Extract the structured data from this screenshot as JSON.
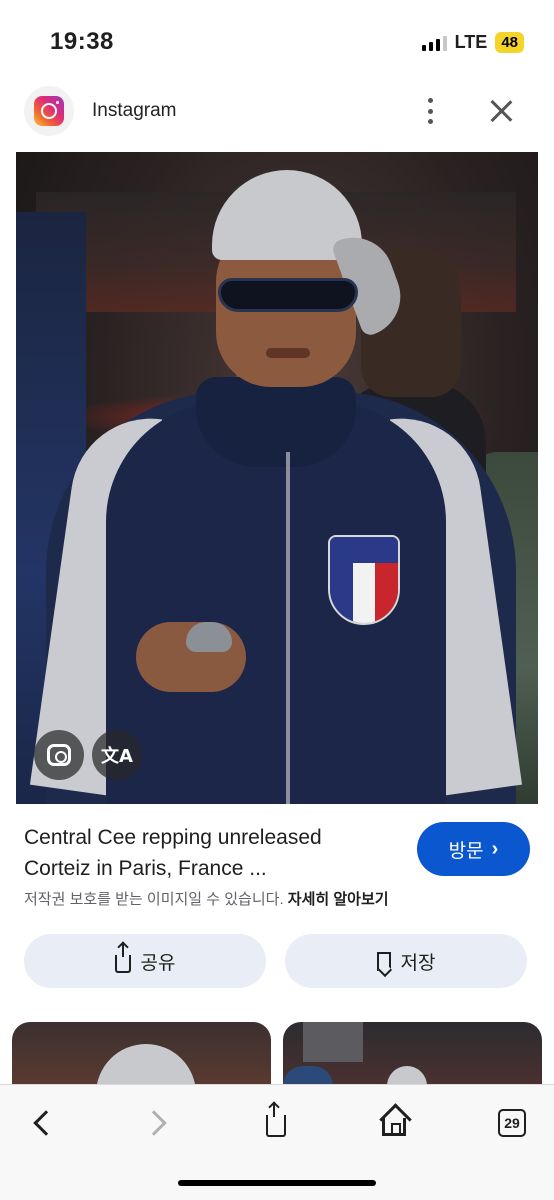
{
  "status_bar": {
    "time": "19:38",
    "network": "LTE",
    "battery": "48"
  },
  "header": {
    "app_name": "Instagram",
    "logo_icon": "instagram-logo",
    "more_icon": "more-vertical-icon",
    "close_icon": "close-icon"
  },
  "image": {
    "lens_icon": "google-lens-icon",
    "translate_icon": "translate-icon",
    "translate_glyph": "文A"
  },
  "result": {
    "caption_line1": "Central Cee repping unreleased",
    "caption_line2": "Corteiz in Paris, France ...",
    "visit_label": "방문",
    "visit_chevron": "›",
    "copyright_text": "저작권 보호를 받는 이미지일 수 있습니다.",
    "learn_more": "자세히 알아보기",
    "share_label": "공유",
    "save_label": "저장"
  },
  "toolbar": {
    "tab_count": "29"
  },
  "colors": {
    "accent": "#0b57d0",
    "chip_bg": "#e9eef6",
    "battery": "#f5d42a"
  }
}
